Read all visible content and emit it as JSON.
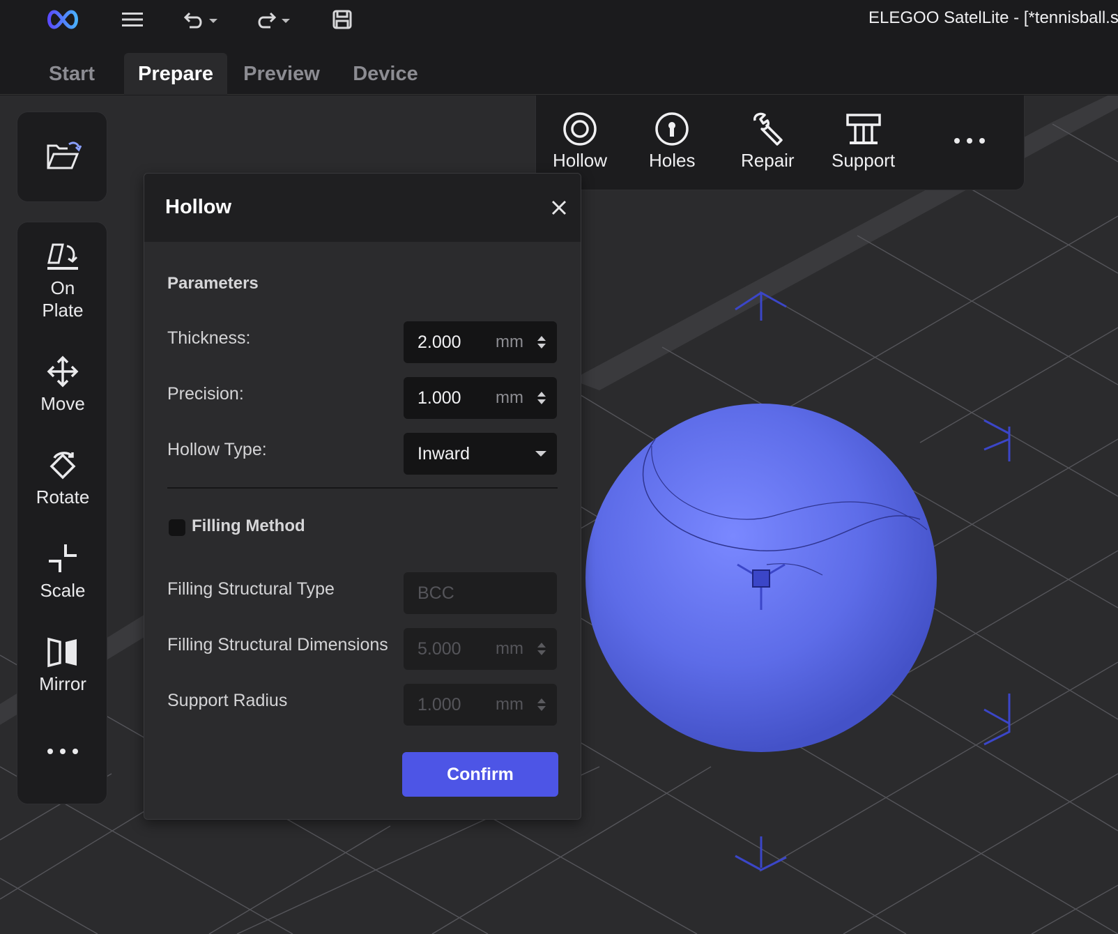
{
  "app": {
    "window_title": "ELEGOO SatelLite - [*tennisball.s"
  },
  "titlebar": {
    "icons": [
      "elegoo-logo-icon",
      "menu-icon",
      "undo-icon",
      "redo-icon",
      "save-icon"
    ]
  },
  "tabs": [
    {
      "label": "Start",
      "active": false
    },
    {
      "label": "Prepare",
      "active": true
    },
    {
      "label": "Preview",
      "active": false
    },
    {
      "label": "Device",
      "active": false
    }
  ],
  "left_toolbar": {
    "open_icon": "folder-open-icon",
    "tools": [
      {
        "label": "On Plate",
        "icon": "lay-flat-icon"
      },
      {
        "label": "Move",
        "icon": "move-arrows-icon"
      },
      {
        "label": "Rotate",
        "icon": "rotate-icon"
      },
      {
        "label": "Scale",
        "icon": "scale-icon"
      },
      {
        "label": "Mirror",
        "icon": "mirror-icon"
      }
    ],
    "more_icon": "more-dots-icon"
  },
  "top_toolbar": {
    "tools": [
      {
        "label": "Hollow",
        "icon": "hollow-circle-icon"
      },
      {
        "label": "Holes",
        "icon": "keyhole-icon"
      },
      {
        "label": "Repair",
        "icon": "wrench-icon"
      },
      {
        "label": "Support",
        "icon": "support-table-icon"
      }
    ],
    "more_icon": "more-dots-icon"
  },
  "hollow_panel": {
    "title": "Hollow",
    "parameters_title": "Parameters",
    "thickness": {
      "label": "Thickness:",
      "value": "2.000",
      "unit": "mm"
    },
    "precision": {
      "label": "Precision:",
      "value": "1.000",
      "unit": "mm"
    },
    "hollow_type": {
      "label": "Hollow Type:",
      "value": "Inward"
    },
    "filling_method": {
      "label": "Filling Method",
      "checked": false
    },
    "filling_structural_type": {
      "label": "Filling Structural Type",
      "value": "BCC"
    },
    "filling_structural_dimensions": {
      "label": "Filling Structural Dimensions",
      "value": "5.000",
      "unit": "mm"
    },
    "support_radius": {
      "label": "Support Radius",
      "value": "1.000",
      "unit": "mm"
    },
    "confirm_label": "Confirm"
  },
  "colors": {
    "background": "#1b1b1d",
    "viewport": "#2b2b2d",
    "accent": "#4d55e6",
    "model": "#5d6ce8"
  }
}
